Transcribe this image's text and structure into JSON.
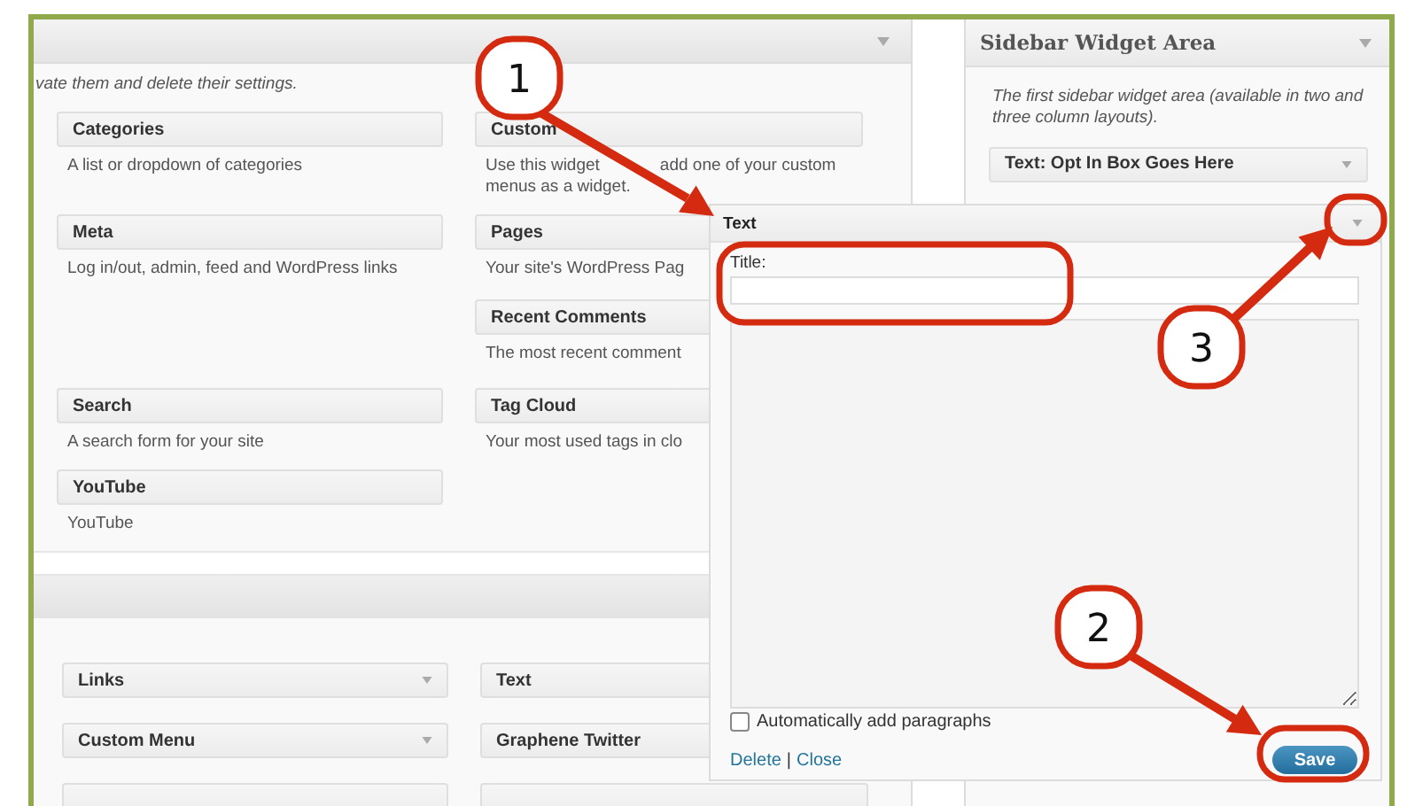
{
  "available_panel": {
    "intro": "vate them and delete their settings.",
    "widget_rows": [
      [
        {
          "name": "Categories",
          "description": "A list or dropdown of categories"
        },
        {
          "name": "Custom",
          "description": "Use this widget",
          "description_2": "add one of your custom",
          "description_3": "menus as a widget."
        }
      ],
      [
        {
          "name": "Meta",
          "description": "Log in/out, admin, feed and WordPress links"
        },
        {
          "name": "Pages",
          "description": "Your site's WordPress Pag"
        }
      ],
      [
        null,
        {
          "name": "Recent Comments",
          "description": "The most recent comment"
        }
      ],
      [
        {
          "name": "Search",
          "description": "A search form for your site"
        },
        {
          "name": "Tag Cloud",
          "description": "Your most used tags in clo"
        }
      ],
      [
        {
          "name": "YouTube",
          "description": "YouTube"
        },
        null
      ]
    ]
  },
  "inactive_panel": {
    "widgets": [
      {
        "name": "Links"
      },
      {
        "name": "Text"
      },
      {
        "name": "Custom Menu"
      },
      {
        "name": "Graphene Twitter"
      }
    ]
  },
  "sidebar": {
    "title": "Sidebar Widget Area",
    "description": "The first sidebar widget area (available in two and three column layouts).",
    "widgets": [
      {
        "name": "Text: Opt In Box Goes Here"
      }
    ]
  },
  "text_widget": {
    "title": "Text",
    "title_label": "Title:",
    "auto_paragraphs": {
      "label": "Automatically add paragraphs",
      "checked": false
    },
    "links": [
      "Delete",
      "Close"
    ],
    "separator": "|",
    "save": "Save"
  },
  "callouts": [
    {
      "label": "1"
    },
    {
      "label": "2"
    },
    {
      "label": "3"
    }
  ]
}
